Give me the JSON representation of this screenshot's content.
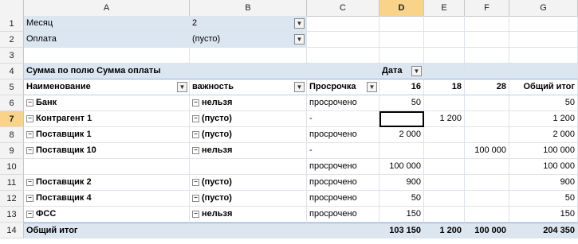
{
  "columns": [
    "A",
    "B",
    "C",
    "D",
    "E",
    "F",
    "G"
  ],
  "rows": [
    "1",
    "2",
    "3",
    "4",
    "5",
    "6",
    "7",
    "8",
    "9",
    "10",
    "11",
    "12",
    "13",
    "14"
  ],
  "filters": [
    {
      "label": "Месяц",
      "value": "2"
    },
    {
      "label": "Оплата",
      "value": "(пусто)"
    }
  ],
  "pivot": {
    "values_caption": "Сумма по полю Сумма оплаты",
    "col_field": "Дата",
    "row_headers": {
      "name": "Наименование",
      "importance": "важность",
      "overdue": "Просрочка"
    },
    "date_cols": [
      "16",
      "18",
      "28"
    ],
    "grand_total_label": "Общий итог",
    "data_rows": [
      {
        "name": "Банк",
        "importance": "нельзя",
        "overdue": "просрочено",
        "d16": "50",
        "d18": "",
        "d28": "",
        "total": "50"
      },
      {
        "name": "Контрагент 1",
        "importance": "(пусто)",
        "overdue": "-",
        "d16": "",
        "d18": "1 200",
        "d28": "",
        "total": "1 200"
      },
      {
        "name": "Поставщик 1",
        "importance": "(пусто)",
        "overdue": "просрочено",
        "d16": "2 000",
        "d18": "",
        "d28": "",
        "total": "2 000"
      },
      {
        "name": "Поставщик 10",
        "importance": "нельзя",
        "overdue": "-",
        "d16": "",
        "d18": "",
        "d28": "100 000",
        "total": "100 000"
      },
      {
        "name": "",
        "importance": "",
        "overdue": "просрочено",
        "d16": "100 000",
        "d18": "",
        "d28": "",
        "total": "100 000"
      },
      {
        "name": "Поставщик 2",
        "importance": "(пусто)",
        "overdue": "просрочено",
        "d16": "900",
        "d18": "",
        "d28": "",
        "total": "900"
      },
      {
        "name": "Поставщик 4",
        "importance": "(пусто)",
        "overdue": "просрочено",
        "d16": "50",
        "d18": "",
        "d28": "",
        "total": "50"
      },
      {
        "name": "ФСС",
        "importance": "нельзя",
        "overdue": "просрочено",
        "d16": "150",
        "d18": "",
        "d28": "",
        "total": "150"
      }
    ],
    "grand_totals": {
      "d16": "103 150",
      "d18": "1 200",
      "d28": "100 000",
      "total": "204 350"
    }
  },
  "selection": {
    "column": "D",
    "row": "7"
  },
  "colors": {
    "band": "#dce6f1",
    "border": "#95b3d7",
    "selected_header": "#f9d38a"
  }
}
